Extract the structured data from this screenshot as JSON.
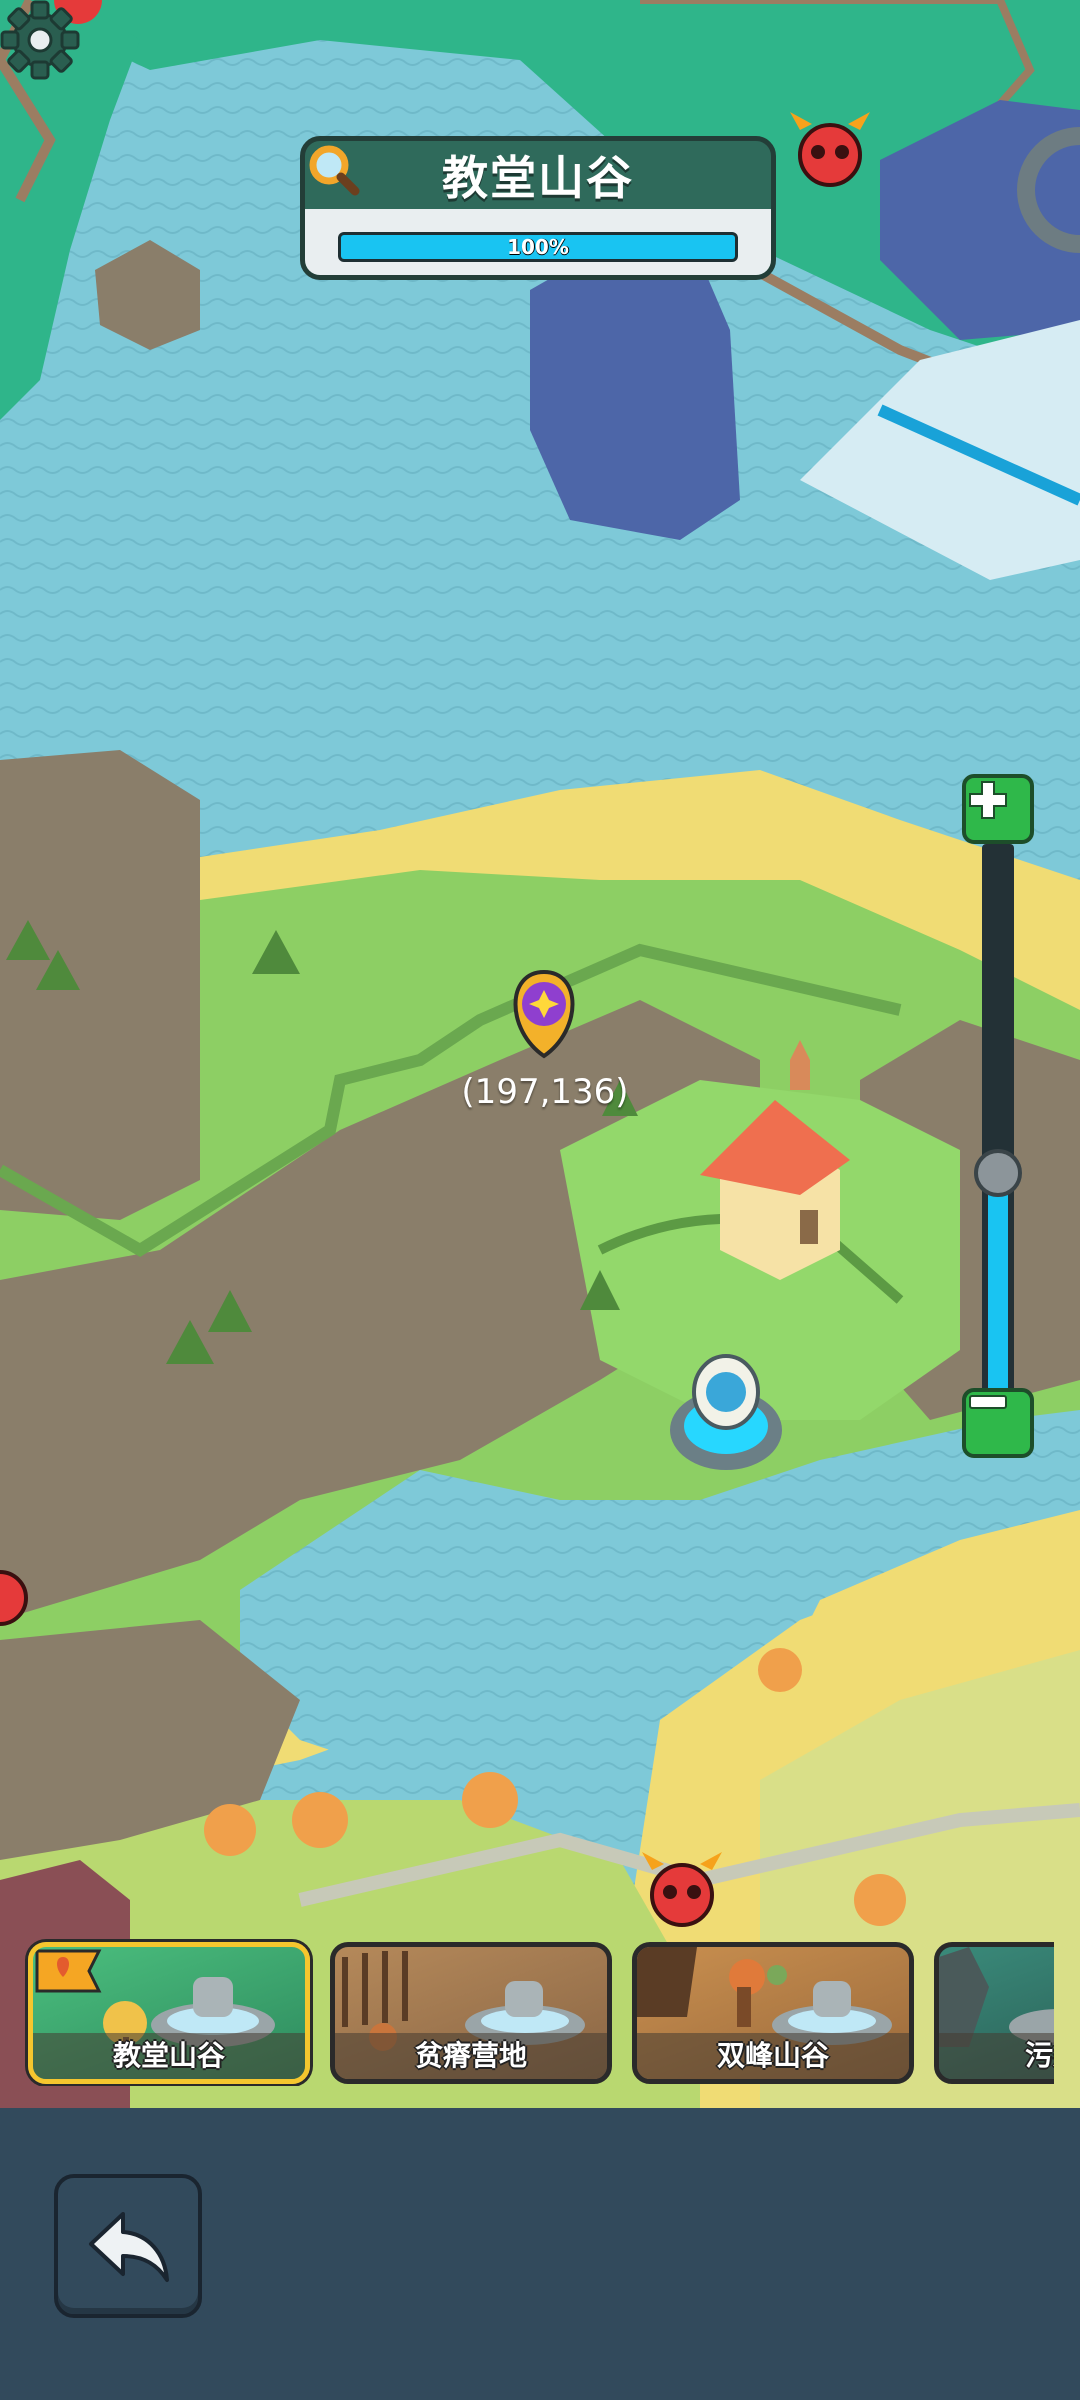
{
  "region_banner": {
    "title": "教堂山谷",
    "progress_text": "100%",
    "progress": 1.0,
    "search_icon": "magnifier-icon"
  },
  "map": {
    "coordinate": "(197,136)",
    "marker_icon": "location-pin-icon",
    "portal_icon": "portal-icon",
    "church_icon": "church-icon",
    "enemy_icon": "demon-skull-icon"
  },
  "controls": {
    "settings_icon": "gear-icon",
    "zoom_in_icon": "plus-icon",
    "zoom_out_icon": "minus-icon",
    "zoom_level": 0.4
  },
  "regions": [
    {
      "label": "教堂山谷",
      "selected": true
    },
    {
      "label": "贫瘠营地",
      "selected": false
    },
    {
      "label": "双峰山谷",
      "selected": false
    },
    {
      "label": "污染",
      "selected": false
    }
  ],
  "bottom_bar": {
    "back_icon": "back-arrow-icon"
  },
  "colors": {
    "water": "#7ec9d8",
    "grass": "#8dcf64",
    "sand": "#f0dc74",
    "rock": "#8a7e6a",
    "accent": "#19c4f2",
    "button_green": "#2fb84a",
    "banner": "#2f6a5b"
  }
}
